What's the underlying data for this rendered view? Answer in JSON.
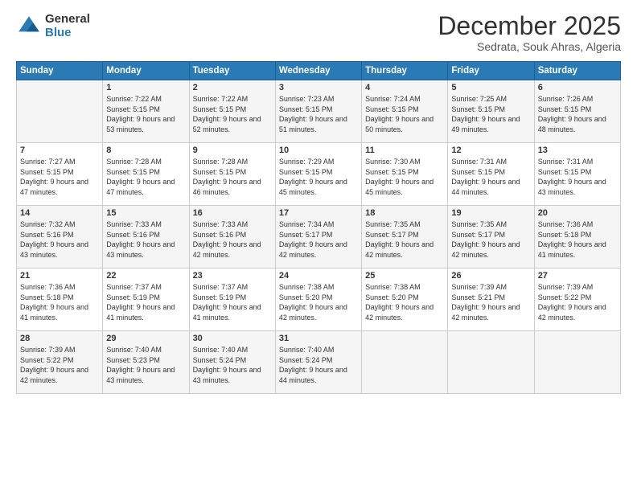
{
  "logo": {
    "general": "General",
    "blue": "Blue"
  },
  "header": {
    "month": "December 2025",
    "location": "Sedrata, Souk Ahras, Algeria"
  },
  "weekdays": [
    "Sunday",
    "Monday",
    "Tuesday",
    "Wednesday",
    "Thursday",
    "Friday",
    "Saturday"
  ],
  "weeks": [
    [
      {
        "day": "",
        "sunrise": "",
        "sunset": "",
        "daylight": ""
      },
      {
        "day": "1",
        "sunrise": "Sunrise: 7:22 AM",
        "sunset": "Sunset: 5:15 PM",
        "daylight": "Daylight: 9 hours and 53 minutes."
      },
      {
        "day": "2",
        "sunrise": "Sunrise: 7:22 AM",
        "sunset": "Sunset: 5:15 PM",
        "daylight": "Daylight: 9 hours and 52 minutes."
      },
      {
        "day": "3",
        "sunrise": "Sunrise: 7:23 AM",
        "sunset": "Sunset: 5:15 PM",
        "daylight": "Daylight: 9 hours and 51 minutes."
      },
      {
        "day": "4",
        "sunrise": "Sunrise: 7:24 AM",
        "sunset": "Sunset: 5:15 PM",
        "daylight": "Daylight: 9 hours and 50 minutes."
      },
      {
        "day": "5",
        "sunrise": "Sunrise: 7:25 AM",
        "sunset": "Sunset: 5:15 PM",
        "daylight": "Daylight: 9 hours and 49 minutes."
      },
      {
        "day": "6",
        "sunrise": "Sunrise: 7:26 AM",
        "sunset": "Sunset: 5:15 PM",
        "daylight": "Daylight: 9 hours and 48 minutes."
      }
    ],
    [
      {
        "day": "7",
        "sunrise": "Sunrise: 7:27 AM",
        "sunset": "Sunset: 5:15 PM",
        "daylight": "Daylight: 9 hours and 47 minutes."
      },
      {
        "day": "8",
        "sunrise": "Sunrise: 7:28 AM",
        "sunset": "Sunset: 5:15 PM",
        "daylight": "Daylight: 9 hours and 47 minutes."
      },
      {
        "day": "9",
        "sunrise": "Sunrise: 7:28 AM",
        "sunset": "Sunset: 5:15 PM",
        "daylight": "Daylight: 9 hours and 46 minutes."
      },
      {
        "day": "10",
        "sunrise": "Sunrise: 7:29 AM",
        "sunset": "Sunset: 5:15 PM",
        "daylight": "Daylight: 9 hours and 45 minutes."
      },
      {
        "day": "11",
        "sunrise": "Sunrise: 7:30 AM",
        "sunset": "Sunset: 5:15 PM",
        "daylight": "Daylight: 9 hours and 45 minutes."
      },
      {
        "day": "12",
        "sunrise": "Sunrise: 7:31 AM",
        "sunset": "Sunset: 5:15 PM",
        "daylight": "Daylight: 9 hours and 44 minutes."
      },
      {
        "day": "13",
        "sunrise": "Sunrise: 7:31 AM",
        "sunset": "Sunset: 5:15 PM",
        "daylight": "Daylight: 9 hours and 43 minutes."
      }
    ],
    [
      {
        "day": "14",
        "sunrise": "Sunrise: 7:32 AM",
        "sunset": "Sunset: 5:16 PM",
        "daylight": "Daylight: 9 hours and 43 minutes."
      },
      {
        "day": "15",
        "sunrise": "Sunrise: 7:33 AM",
        "sunset": "Sunset: 5:16 PM",
        "daylight": "Daylight: 9 hours and 43 minutes."
      },
      {
        "day": "16",
        "sunrise": "Sunrise: 7:33 AM",
        "sunset": "Sunset: 5:16 PM",
        "daylight": "Daylight: 9 hours and 42 minutes."
      },
      {
        "day": "17",
        "sunrise": "Sunrise: 7:34 AM",
        "sunset": "Sunset: 5:17 PM",
        "daylight": "Daylight: 9 hours and 42 minutes."
      },
      {
        "day": "18",
        "sunrise": "Sunrise: 7:35 AM",
        "sunset": "Sunset: 5:17 PM",
        "daylight": "Daylight: 9 hours and 42 minutes."
      },
      {
        "day": "19",
        "sunrise": "Sunrise: 7:35 AM",
        "sunset": "Sunset: 5:17 PM",
        "daylight": "Daylight: 9 hours and 42 minutes."
      },
      {
        "day": "20",
        "sunrise": "Sunrise: 7:36 AM",
        "sunset": "Sunset: 5:18 PM",
        "daylight": "Daylight: 9 hours and 41 minutes."
      }
    ],
    [
      {
        "day": "21",
        "sunrise": "Sunrise: 7:36 AM",
        "sunset": "Sunset: 5:18 PM",
        "daylight": "Daylight: 9 hours and 41 minutes."
      },
      {
        "day": "22",
        "sunrise": "Sunrise: 7:37 AM",
        "sunset": "Sunset: 5:19 PM",
        "daylight": "Daylight: 9 hours and 41 minutes."
      },
      {
        "day": "23",
        "sunrise": "Sunrise: 7:37 AM",
        "sunset": "Sunset: 5:19 PM",
        "daylight": "Daylight: 9 hours and 41 minutes."
      },
      {
        "day": "24",
        "sunrise": "Sunrise: 7:38 AM",
        "sunset": "Sunset: 5:20 PM",
        "daylight": "Daylight: 9 hours and 42 minutes."
      },
      {
        "day": "25",
        "sunrise": "Sunrise: 7:38 AM",
        "sunset": "Sunset: 5:20 PM",
        "daylight": "Daylight: 9 hours and 42 minutes."
      },
      {
        "day": "26",
        "sunrise": "Sunrise: 7:39 AM",
        "sunset": "Sunset: 5:21 PM",
        "daylight": "Daylight: 9 hours and 42 minutes."
      },
      {
        "day": "27",
        "sunrise": "Sunrise: 7:39 AM",
        "sunset": "Sunset: 5:22 PM",
        "daylight": "Daylight: 9 hours and 42 minutes."
      }
    ],
    [
      {
        "day": "28",
        "sunrise": "Sunrise: 7:39 AM",
        "sunset": "Sunset: 5:22 PM",
        "daylight": "Daylight: 9 hours and 42 minutes."
      },
      {
        "day": "29",
        "sunrise": "Sunrise: 7:40 AM",
        "sunset": "Sunset: 5:23 PM",
        "daylight": "Daylight: 9 hours and 43 minutes."
      },
      {
        "day": "30",
        "sunrise": "Sunrise: 7:40 AM",
        "sunset": "Sunset: 5:24 PM",
        "daylight": "Daylight: 9 hours and 43 minutes."
      },
      {
        "day": "31",
        "sunrise": "Sunrise: 7:40 AM",
        "sunset": "Sunset: 5:24 PM",
        "daylight": "Daylight: 9 hours and 44 minutes."
      },
      {
        "day": "",
        "sunrise": "",
        "sunset": "",
        "daylight": ""
      },
      {
        "day": "",
        "sunrise": "",
        "sunset": "",
        "daylight": ""
      },
      {
        "day": "",
        "sunrise": "",
        "sunset": "",
        "daylight": ""
      }
    ]
  ]
}
